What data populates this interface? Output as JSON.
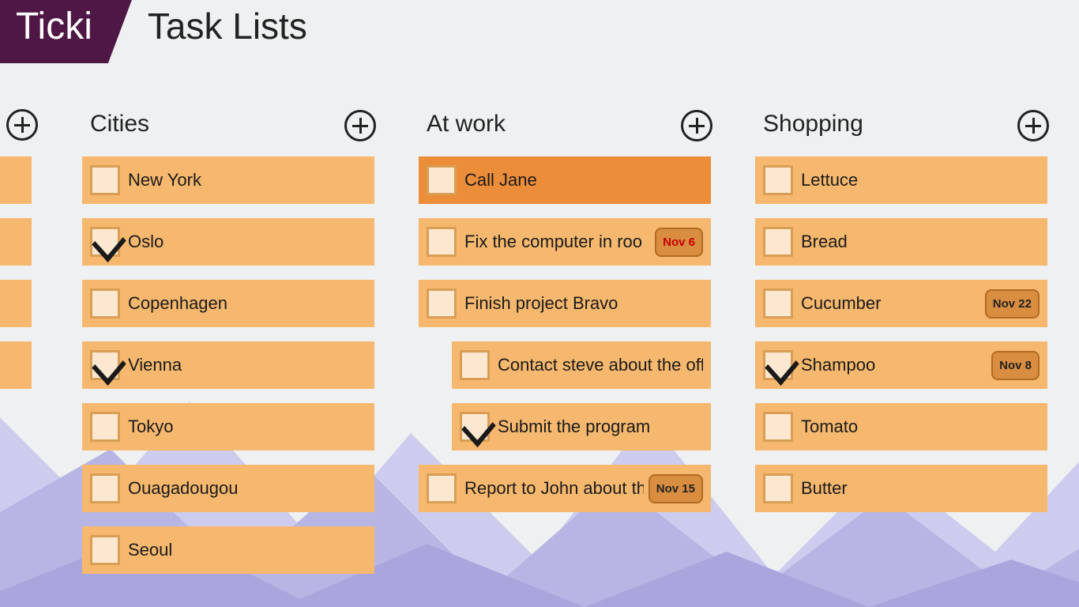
{
  "header": {
    "brand": "Ticki",
    "page_title": "Task Lists"
  },
  "columns": [
    {
      "id": "cities",
      "title": "Cities",
      "items": [
        {
          "label": "New York",
          "checked": false,
          "highlight": false,
          "indent": false
        },
        {
          "label": "Oslo",
          "checked": true,
          "highlight": false,
          "indent": false
        },
        {
          "label": "Copenhagen",
          "checked": false,
          "highlight": false,
          "indent": false
        },
        {
          "label": "Vienna",
          "checked": true,
          "highlight": false,
          "indent": false
        },
        {
          "label": "Tokyo",
          "checked": false,
          "highlight": false,
          "indent": false
        },
        {
          "label": "Ouagadougou",
          "checked": false,
          "highlight": false,
          "indent": false
        },
        {
          "label": "Seoul",
          "checked": false,
          "highlight": false,
          "indent": false
        }
      ]
    },
    {
      "id": "at-work",
      "title": "At work",
      "items": [
        {
          "label": "Call Jane",
          "checked": false,
          "highlight": true,
          "indent": false
        },
        {
          "label": "Fix the computer in roo",
          "checked": false,
          "highlight": false,
          "indent": false,
          "badge": "Nov 6",
          "badge_urgent": true
        },
        {
          "label": "Finish project Bravo",
          "checked": false,
          "highlight": false,
          "indent": false
        },
        {
          "label": "Contact steve about the off",
          "checked": false,
          "highlight": false,
          "indent": true
        },
        {
          "label": "Submit the program",
          "checked": true,
          "highlight": false,
          "indent": true
        },
        {
          "label": "Report to John about th",
          "checked": false,
          "highlight": false,
          "indent": false,
          "badge": "Nov 15"
        }
      ]
    },
    {
      "id": "shopping",
      "title": "Shopping",
      "items": [
        {
          "label": "Lettuce",
          "checked": false,
          "highlight": false,
          "indent": false
        },
        {
          "label": "Bread",
          "checked": false,
          "highlight": false,
          "indent": false
        },
        {
          "label": "Cucumber",
          "checked": false,
          "highlight": false,
          "indent": false,
          "badge": "Nov 22"
        },
        {
          "label": "Shampoo",
          "checked": true,
          "highlight": false,
          "indent": false,
          "badge": "Nov 8"
        },
        {
          "label": "Tomato",
          "checked": false,
          "highlight": false,
          "indent": false
        },
        {
          "label": "Butter",
          "checked": false,
          "highlight": false,
          "indent": false
        }
      ]
    }
  ]
}
